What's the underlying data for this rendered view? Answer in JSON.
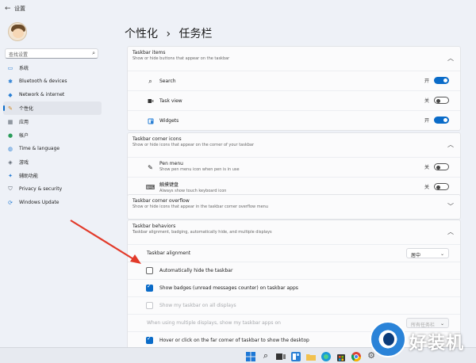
{
  "window": {
    "title": "设置",
    "back_glyph": "←"
  },
  "nav": {
    "search_placeholder": "查找设置",
    "items": [
      {
        "label": "系统",
        "icon": "monitor-icon",
        "icon_color": "#2a7fd4"
      },
      {
        "label": "Bluetooth & devices",
        "icon": "bluetooth-icon",
        "icon_color": "#2a7fd4"
      },
      {
        "label": "Network & internet",
        "icon": "wifi-icon",
        "icon_color": "#2a7fd4"
      },
      {
        "label": "个性化",
        "icon": "brush-icon",
        "icon_color": "#d08a2a"
      },
      {
        "label": "应用",
        "icon": "apps-icon",
        "icon_color": "#5c6570"
      },
      {
        "label": "帐户",
        "icon": "person-icon",
        "icon_color": "#2a9c5a"
      },
      {
        "label": "Time & language",
        "icon": "globe-icon",
        "icon_color": "#2a7fd4"
      },
      {
        "label": "游戏",
        "icon": "gamepad-icon",
        "icon_color": "#5c6570"
      },
      {
        "label": "辅助功能",
        "icon": "accessibility-icon",
        "icon_color": "#2a7fd4"
      },
      {
        "label": "Privacy & security",
        "icon": "shield-icon",
        "icon_color": "#5c6570"
      },
      {
        "label": "Windows Update",
        "icon": "update-icon",
        "icon_color": "#2a7fd4"
      }
    ],
    "active_index": 3
  },
  "breadcrumb": {
    "parent": "个性化",
    "sep": "›",
    "current": "任务栏"
  },
  "taskbar_items": {
    "title": "Taskbar items",
    "desc": "Show or hide buttons that appear on the taskbar",
    "rows": [
      {
        "label": "Search",
        "state": "开",
        "on": true,
        "icon": "search-icon"
      },
      {
        "label": "Task view",
        "state": "关",
        "on": false,
        "icon": "taskview-icon"
      },
      {
        "label": "Widgets",
        "state": "开",
        "on": true,
        "icon": "widgets-icon"
      }
    ]
  },
  "corner_icons": {
    "title": "Taskbar corner icons",
    "desc": "Show or hide icons that appear on the corner of your taskbar",
    "rows": [
      {
        "label": "Pen menu",
        "sub": "Show pen menu icon when pen is in use",
        "state": "关",
        "icon": "pen-icon"
      },
      {
        "label": "触摸键盘",
        "sub": "Always show touch keyboard icon",
        "state": "关",
        "icon": "keyboard-icon"
      }
    ]
  },
  "overflow": {
    "title": "Taskbar corner overflow",
    "desc": "Show or hide icons that appear in the taskbar corner overflow menu"
  },
  "behaviors": {
    "title": "Taskbar behaviors",
    "desc": "Taskbar alignment, badging, automatically hide, and multiple displays",
    "alignment_label": "Taskbar alignment",
    "alignment_value": "居中",
    "auto_hide": "Automatically hide the taskbar",
    "badges": "Show badges (unread messages counter) on taskbar apps",
    "all_displays": "Show my taskbar on all displays",
    "multi_display": "When using multiple displays, show my taskbar apps on",
    "multi_display_value": "所有任务栏",
    "hover_desktop": "Hover or click on the far corner of taskbar to show the desktop"
  },
  "chevrons": {
    "up": "︿",
    "down": "﹀",
    "dropdown": "⌄"
  },
  "watermark": {
    "text": "好装机"
  },
  "colors": {
    "accent": "#0a6bc8",
    "arrow": "#e23a2a"
  }
}
